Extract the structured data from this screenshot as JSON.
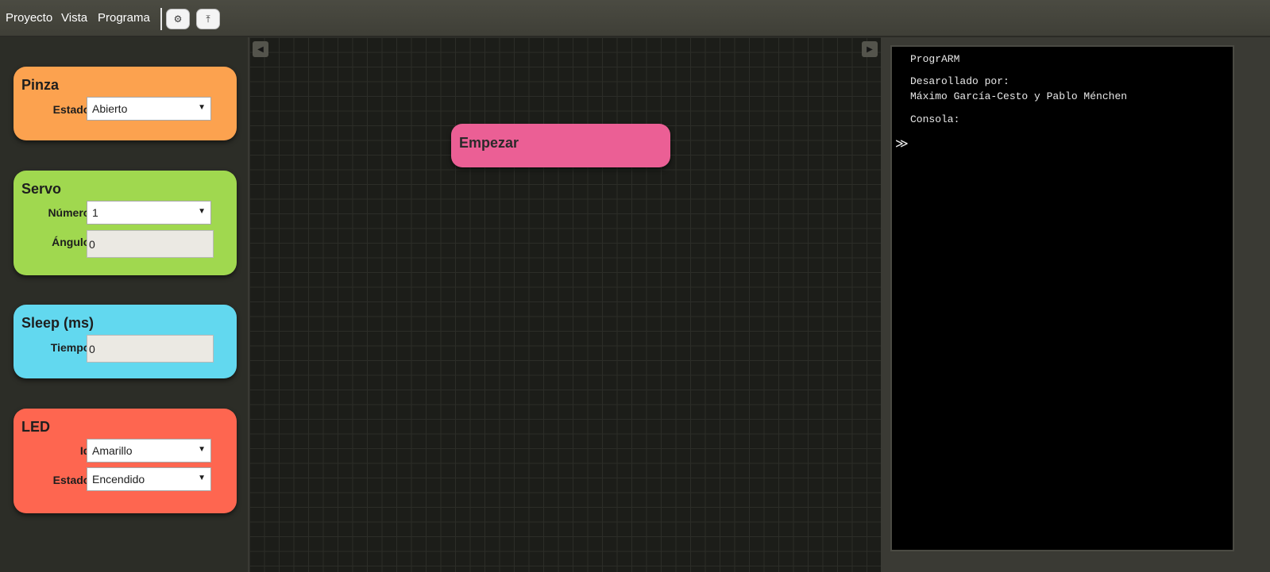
{
  "menu": {
    "items": [
      "Proyecto",
      "Vista",
      "Programa"
    ],
    "toolbar": {
      "settings_icon": "gear-icon",
      "upload_icon": "upload-icon",
      "settings_glyph": "⚙",
      "upload_glyph": "⤒"
    }
  },
  "palette": {
    "pinza": {
      "title": "Pinza",
      "estado_label": "Estado:",
      "estado_value": "Abierto",
      "color": "#fca24f"
    },
    "servo": {
      "title": "Servo",
      "numero_label": "Número:",
      "numero_value": "1",
      "angulo_label": "Ángulo:",
      "angulo_value": "0",
      "color": "#a0d84f"
    },
    "sleep": {
      "title": "Sleep (ms)",
      "tiempo_label": "Tiempo:",
      "tiempo_value": "0",
      "color": "#62d8ef"
    },
    "led": {
      "title": "LED",
      "id_label": "Id:",
      "id_value": "Amarillo",
      "estado_label": "Estado:",
      "estado_value": "Encendido",
      "color": "#fe6650"
    }
  },
  "canvas": {
    "start_block": {
      "label": "Empezar",
      "color": "#eb5f95"
    },
    "scroll_left_glyph": "◀",
    "scroll_right_glyph": "▶"
  },
  "console": {
    "app_name": "ProgrARM",
    "developed_by": "Desarollado por:",
    "authors": "Máximo García-Cesto y Pablo Ménchen",
    "console_label": "Consola:",
    "prompt": "≫"
  }
}
